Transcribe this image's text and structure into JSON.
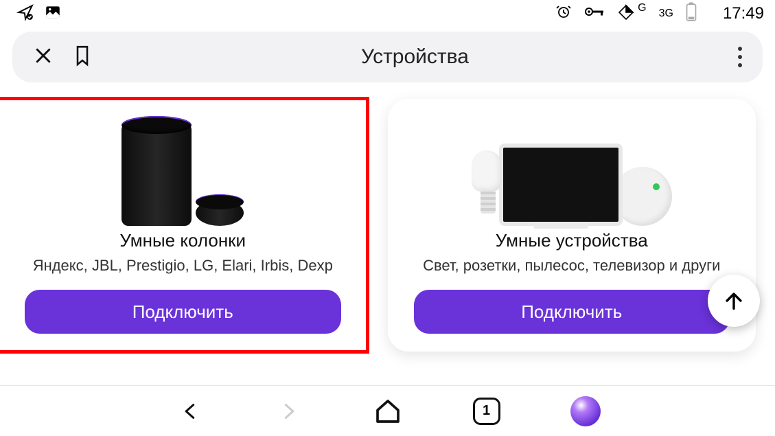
{
  "status_bar": {
    "network1": "G",
    "network2": "3G",
    "time": "17:49"
  },
  "appbar": {
    "title": "Устройства"
  },
  "cards": [
    {
      "title": "Умные колонки",
      "subtitle": "Яндекс, JBL, Prestigio, LG, Elari, Irbis, Dexp",
      "button": "Подключить"
    },
    {
      "title": "Умные устройства",
      "subtitle": "Свет, розетки, пылесос, телевизор и други",
      "button": "Подключить"
    }
  ],
  "bottom_nav": {
    "tab_count": "1"
  }
}
